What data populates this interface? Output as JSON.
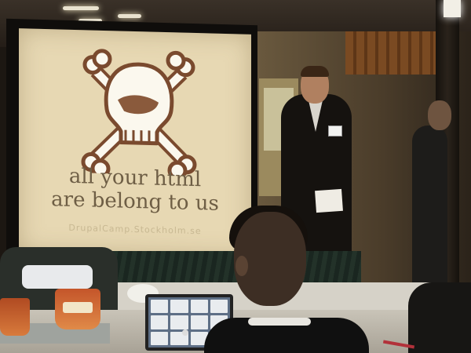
{
  "slide": {
    "line1": "all your html",
    "line2": "are belong to us",
    "url": "DrupalCamp.Stockholm.se",
    "text_color": "#6e5e45",
    "screen_color": "#e7d8b3",
    "logo": "skull-and-crossbones",
    "logo_colors": {
      "bone": "#fbf8ee",
      "outline": "#7a4a2e",
      "eye_patch": "#8a5a3c"
    }
  }
}
